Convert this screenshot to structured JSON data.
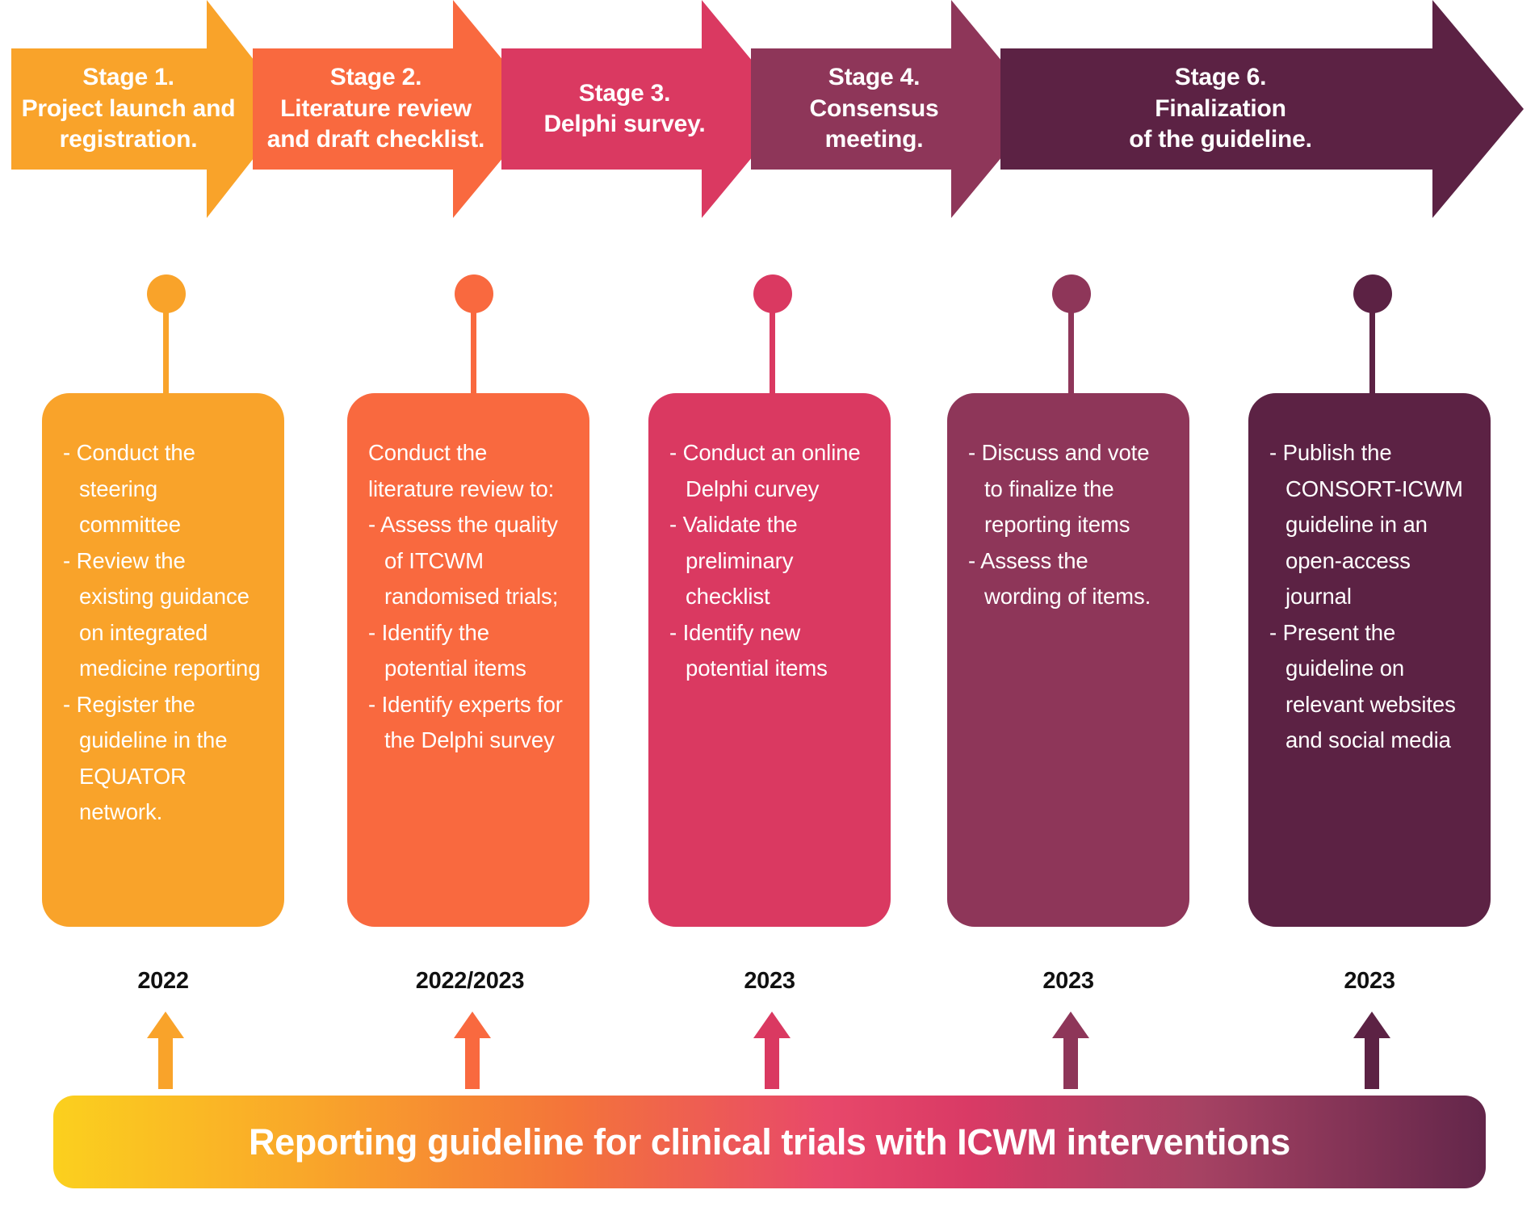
{
  "figure": {
    "banner_title": "Reporting guideline for clinical trials with ICWM interventions"
  },
  "stages": [
    {
      "id": "stage-1",
      "arrow_label": "Stage 1.\nProject launch and\nregistration.",
      "color": "#f9a32a",
      "year": "2022",
      "items": [
        {
          "text": "- Conduct the steering committee",
          "bullet": true
        },
        {
          "text": "- Review the existing guidance on integrated medicine reporting",
          "bullet": true
        },
        {
          "text": "- Register the guideline in the EQUATOR network.",
          "bullet": true
        }
      ]
    },
    {
      "id": "stage-2",
      "arrow_label": "Stage 2.\nLiterature review\nand draft checklist.",
      "color": "#f9693f",
      "year": "2022/2023",
      "items": [
        {
          "text": "Conduct the literature review to:",
          "bullet": false
        },
        {
          "text": "- Assess the quality of ITCWM randomised trials;",
          "bullet": true
        },
        {
          "text": "- Identify the potential items",
          "bullet": true
        },
        {
          "text": "- Identify experts for the Delphi survey",
          "bullet": true
        }
      ]
    },
    {
      "id": "stage-3",
      "arrow_label": "Stage 3.\nDelphi survey.",
      "color": "#da3961",
      "year": "2023",
      "items": [
        {
          "text": "- Conduct an online Delphi curvey",
          "bullet": true
        },
        {
          "text": "- Validate the preliminary checklist",
          "bullet": true
        },
        {
          "text": "- Identify new potential items",
          "bullet": true
        }
      ]
    },
    {
      "id": "stage-4",
      "arrow_label": "Stage 4.\nConsensus\nmeeting.",
      "color": "#8e3659",
      "year": "2023",
      "items": [
        {
          "text": "- Discuss and vote to finalize the reporting items",
          "bullet": true
        },
        {
          "text": "- Assess the wording of items.",
          "bullet": true
        }
      ]
    },
    {
      "id": "stage-6",
      "arrow_label": "Stage 6.\nFinalization\nof the guideline.",
      "color": "#5c2244",
      "year": "2023",
      "items": [
        {
          "text": "- Publish the CONSORT-ICWM guideline in an open-access journal",
          "bullet": true
        },
        {
          "text": "- Present the guideline on relevant websites and social media",
          "bullet": true
        }
      ]
    }
  ]
}
